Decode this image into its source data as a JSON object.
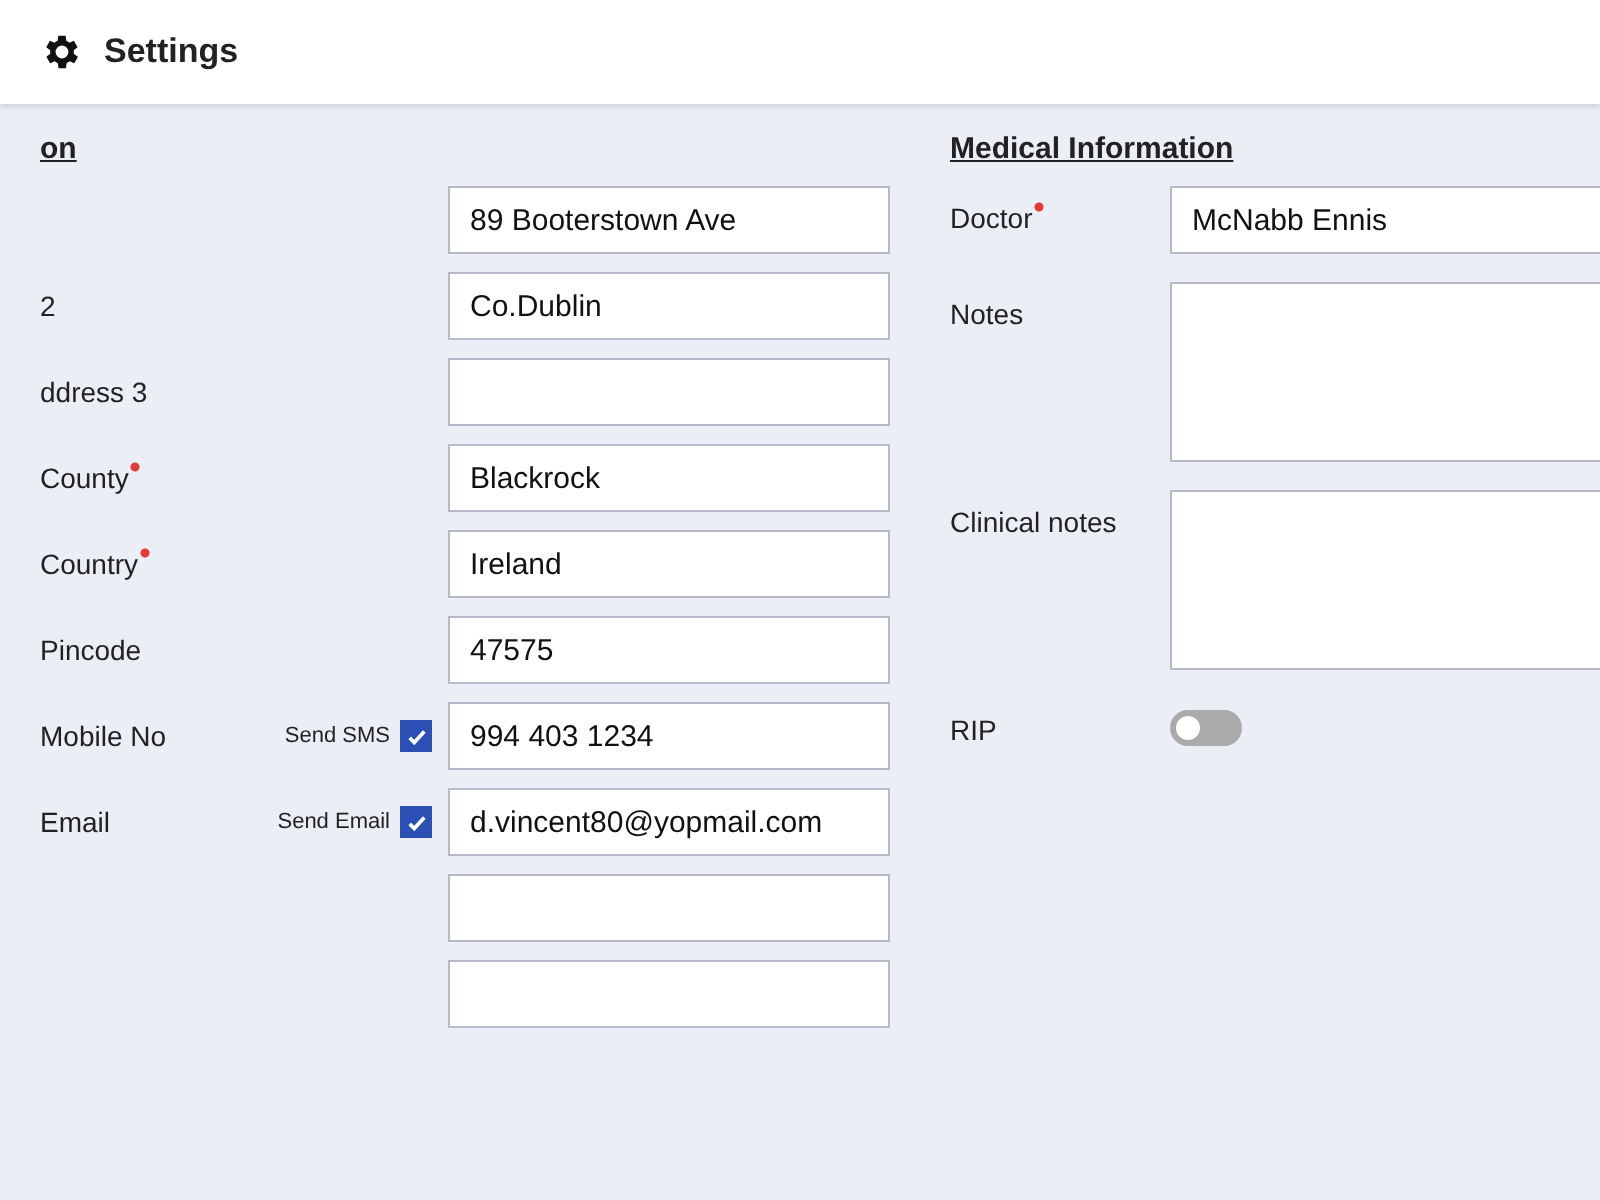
{
  "header": {
    "title": "Settings"
  },
  "personal": {
    "heading": "on",
    "rows": [
      {
        "value": "89 Booterstown Ave"
      },
      {
        "label": "2",
        "required": false,
        "value": "Co.Dublin"
      },
      {
        "label": "ddress 3",
        "required": false
      },
      {
        "label": "County",
        "required": true,
        "value": "Blackrock"
      },
      {
        "label": "Country",
        "required": true,
        "value": "Ireland"
      },
      {
        "label": "Pincode",
        "required": false,
        "value": "47575"
      },
      {
        "label": "Mobile No",
        "required": false,
        "value": "994 403 1234",
        "checkbox": {
          "label": "Send SMS",
          "checked": true
        }
      },
      {
        "label": "Email",
        "required": false,
        "value": "d.vincent80@yopmail.com",
        "checkbox": {
          "label": "Send Email",
          "checked": true
        }
      },
      {},
      {}
    ]
  },
  "medical": {
    "heading": "Medical Information",
    "rows": [
      {
        "kind": "input",
        "label": "Doctor",
        "required": true,
        "value": "McNabb Ennis"
      },
      {
        "kind": "textarea",
        "label": "Notes",
        "required": false
      },
      {
        "kind": "textarea",
        "label": "Clinical notes",
        "required": false
      },
      {
        "kind": "toggle",
        "label": "RIP",
        "required": false,
        "on": false
      }
    ]
  }
}
